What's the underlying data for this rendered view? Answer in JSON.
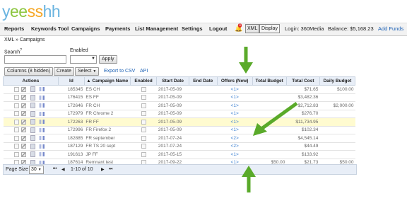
{
  "logo": {
    "text": "yeesshh"
  },
  "nav": {
    "items": [
      "Reports",
      "Keywords Tool",
      "Campaigns",
      "Payments",
      "List Management",
      "Settings",
      "Logout"
    ],
    "notif_count": "3",
    "xml_label": "XML",
    "display_label": "Display",
    "login": "Login: 360Media",
    "balance": "Balance: $5,168.23",
    "add_funds": "Add Funds"
  },
  "breadcrumb": {
    "root": "XML",
    "sep": "»",
    "current": "Campaigns"
  },
  "filters": {
    "search_label": "Search",
    "search_sup": "?",
    "enabled_label": "Enabled",
    "apply": "Apply"
  },
  "toolbar": {
    "columns": "Columns (8 hidden)",
    "create": "Create",
    "select": "Select",
    "export": "Export to CSV",
    "api": "API"
  },
  "table": {
    "headers": [
      "Actions",
      "Id",
      "▲ Campaign Name",
      "Enabled",
      "Start Date",
      "End Date",
      "Offers (New)",
      "Total Budget",
      "Total Cost",
      "Daily Budget"
    ],
    "rows": [
      {
        "id": "185345",
        "name": "ES CH",
        "start": "2017-05-09",
        "end": "",
        "offers": "<1>",
        "budget": "",
        "cost": "$71.65",
        "daily": "$100.00"
      },
      {
        "id": "176415",
        "name": "ES FF",
        "start": "2017-05-09",
        "end": "",
        "offers": "<1>",
        "budget": "",
        "cost": "$3,482.36",
        "daily": ""
      },
      {
        "id": "172646",
        "name": "FR CH",
        "start": "2017-05-09",
        "end": "",
        "offers": "<1>",
        "budget": "",
        "cost": "$2,712.83",
        "daily": "$2,000.00"
      },
      {
        "id": "172979",
        "name": "FR Chrome 2",
        "start": "2017-05-09",
        "end": "",
        "offers": "<1>",
        "budget": "",
        "cost": "$276.70",
        "daily": ""
      },
      {
        "id": "172263",
        "name": "FR FF",
        "start": "2017-05-09",
        "end": "",
        "offers": "<1>",
        "budget": "",
        "cost": "$11,734.95",
        "daily": ""
      },
      {
        "id": "172996",
        "name": "FR Firefox 2",
        "start": "2017-05-09",
        "end": "",
        "offers": "<1>",
        "budget": "",
        "cost": "$102.34",
        "daily": ""
      },
      {
        "id": "182885",
        "name": "FR september",
        "start": "2017-07-24",
        "end": "",
        "offers": "<2>",
        "budget": "",
        "cost": "$4,545.14",
        "daily": ""
      },
      {
        "id": "187129",
        "name": "FR TS 20 sept",
        "start": "2017-07-24",
        "end": "",
        "offers": "<2>",
        "budget": "",
        "cost": "$44.49",
        "daily": ""
      },
      {
        "id": "191613",
        "name": "JP FF",
        "start": "2017-05-15",
        "end": "",
        "offers": "<1>",
        "budget": "",
        "cost": "$133.92",
        "daily": ""
      },
      {
        "id": "187614",
        "name": "Remnant test",
        "start": "2017-09-22",
        "end": "",
        "offers": "<1>",
        "budget": "$50.00",
        "cost": "$21.73",
        "daily": "$50.00"
      }
    ]
  },
  "footer": {
    "page_size_label": "Page Size",
    "page_size": "30",
    "range": "1-10 of 10"
  },
  "colors": {
    "accent": "#1a5fb4",
    "arrow": "#5aaa2a",
    "highlight_row": "#fffbd0"
  }
}
